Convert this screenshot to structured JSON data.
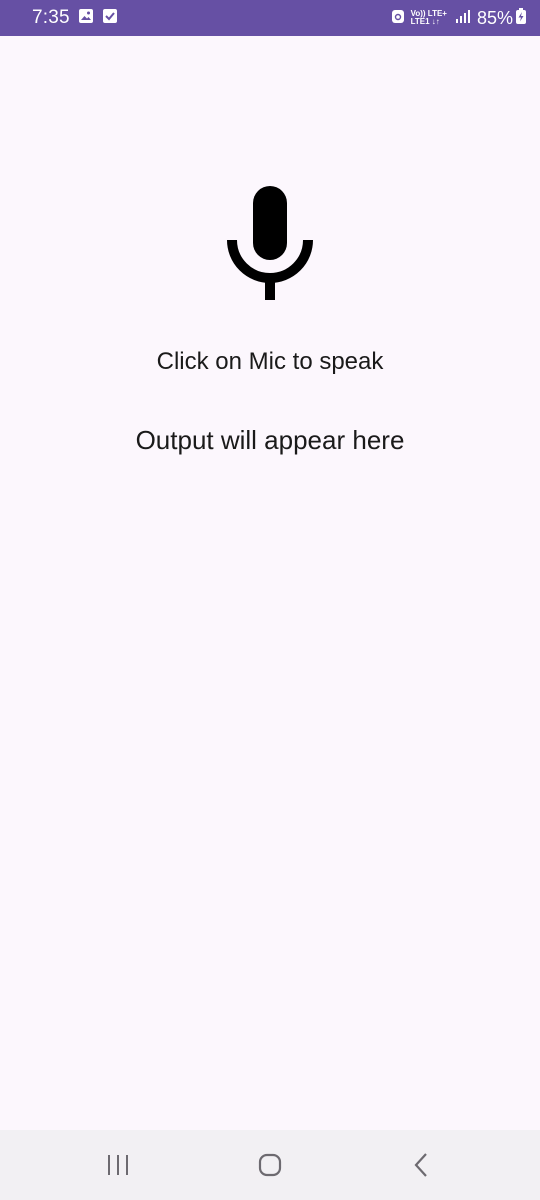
{
  "status_bar": {
    "time": "7:35",
    "network_top": "Vo)) LTE+",
    "network_bottom": "LTE1 ↓↑",
    "battery": "85%",
    "background_color": "#6650a4"
  },
  "main": {
    "prompt": "Click on Mic to speak",
    "output": "Output will appear here",
    "mic_icon": "microphone-icon"
  },
  "nav_bar": {
    "recents_icon": "recents-icon",
    "home_icon": "home-icon",
    "back_icon": "back-icon"
  }
}
